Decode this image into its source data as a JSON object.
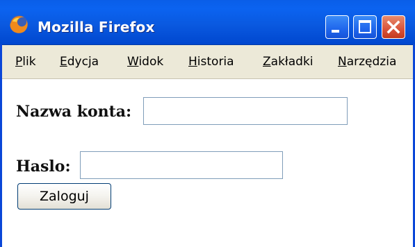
{
  "window": {
    "title": "Mozilla Firefox",
    "icon": "firefox-icon"
  },
  "titlebar_buttons": {
    "minimize": "minimize-icon",
    "maximize": "maximize-icon",
    "close": "close-icon"
  },
  "menu": {
    "items": [
      {
        "label_first": "P",
        "label_rest": "lik"
      },
      {
        "label_first": "E",
        "label_rest": "dycja"
      },
      {
        "label_first": "W",
        "label_rest": "idok"
      },
      {
        "label_first": "H",
        "label_rest": "istoria"
      },
      {
        "label_first": "Z",
        "label_rest": "akładki"
      },
      {
        "label_first": "N",
        "label_rest": "arzędzia"
      }
    ]
  },
  "form": {
    "account_label": "Nazwa konta:",
    "account_value": "",
    "password_label": "Haslo:",
    "password_value": "",
    "login_button": "Zaloguj"
  },
  "colors": {
    "titlebar": "#0a5ee8",
    "menubar": "#ece9d8",
    "input_border": "#7f9db9"
  }
}
